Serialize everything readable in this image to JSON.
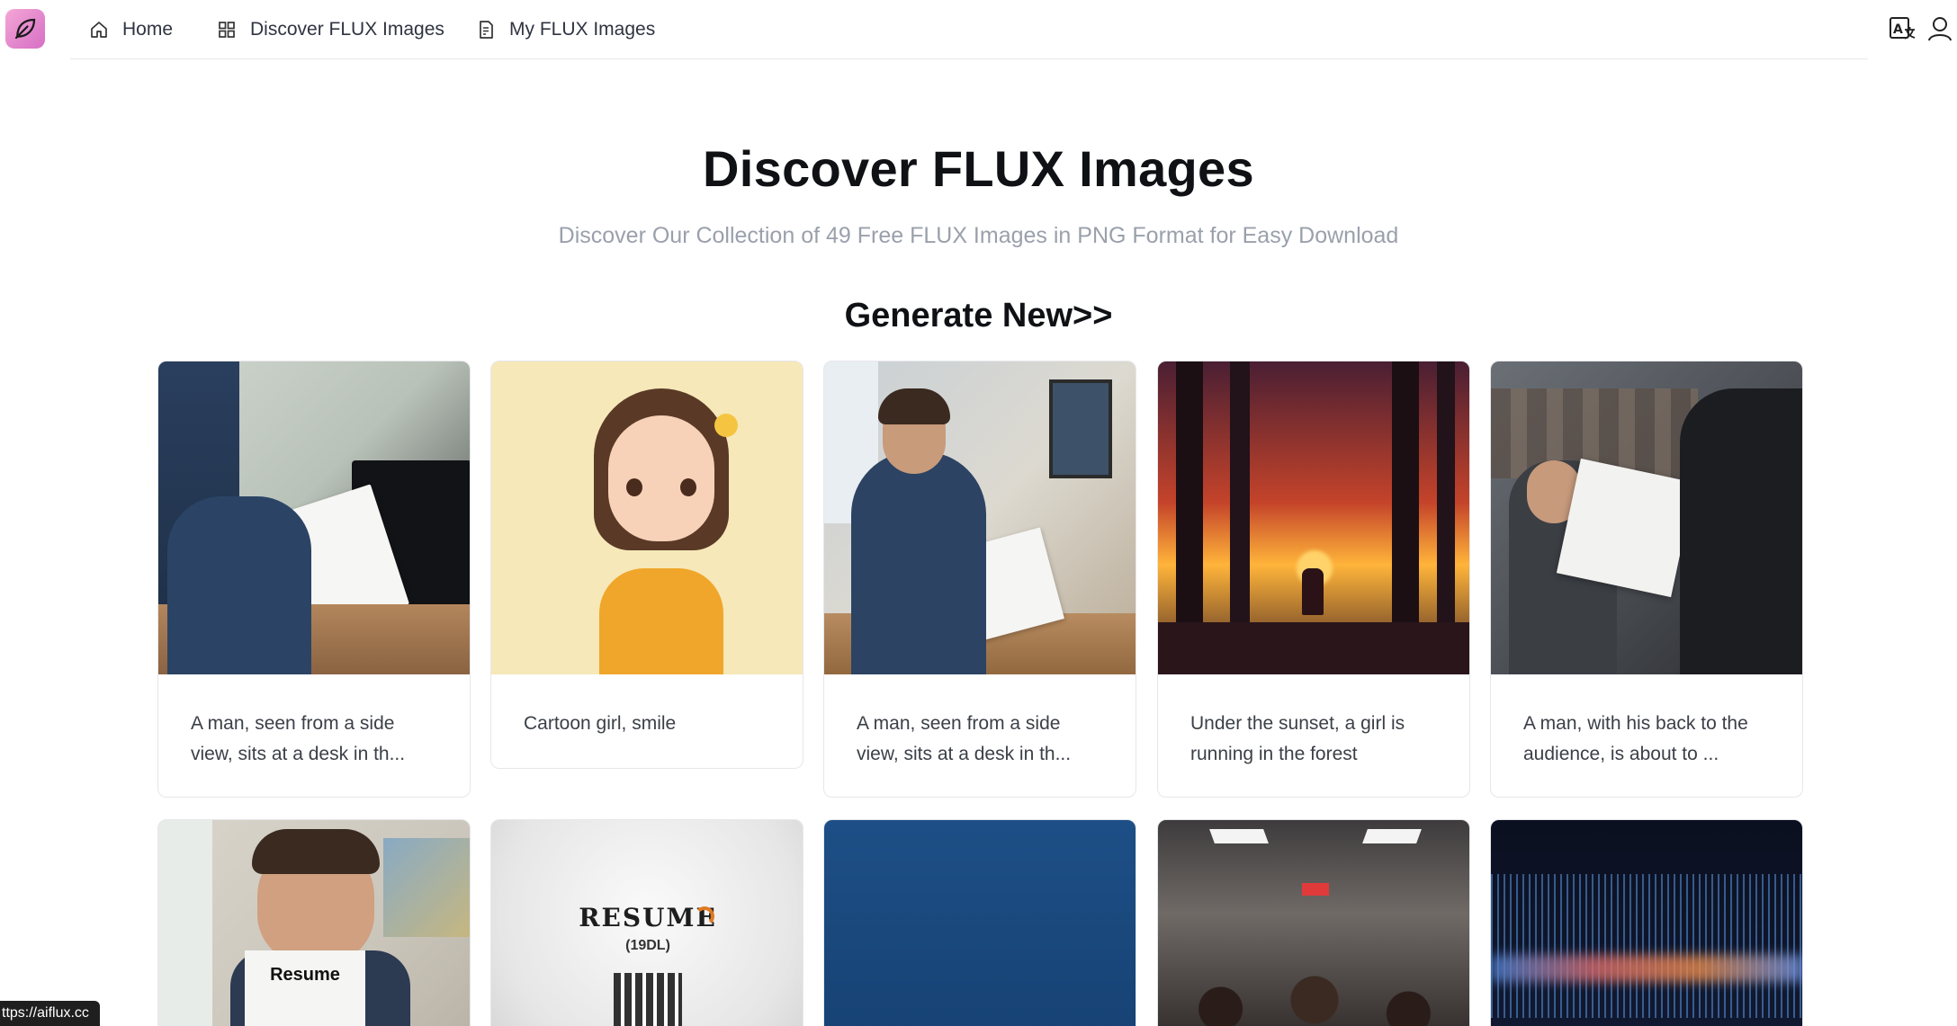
{
  "nav": {
    "items": [
      {
        "label": "Home",
        "icon": "home-icon"
      },
      {
        "label": "Discover FLUX Images",
        "icon": "grid-icon"
      },
      {
        "label": "My FLUX Images",
        "icon": "document-icon"
      }
    ],
    "right_icons": [
      "translate-icon",
      "user-icon"
    ]
  },
  "hero": {
    "title": "Discover FLUX Images",
    "subtitle": "Discover Our Collection of 49 Free FLUX Images in PNG Format for Easy Download",
    "generate_label": "Generate New>>"
  },
  "cards_row1": [
    {
      "caption": "A man, seen from a side view, sits at a desk in th..."
    },
    {
      "caption": "Cartoon girl, smile"
    },
    {
      "caption": "A man, seen from a side view, sits at a desk in th..."
    },
    {
      "caption": "Under the sunset, a girl is running in the forest"
    },
    {
      "caption": "A man, with his back to the audience, is about to ..."
    }
  ],
  "cards_row2": [
    {
      "image_text": "Resume"
    },
    {
      "image_text": "RESUME",
      "image_subtext": "(19DL)"
    },
    {},
    {},
    {}
  ],
  "status_bar": {
    "url": "ttps://aiflux.cc"
  },
  "colors": {
    "accent_logo": "#d66fc5",
    "muted_text": "#9aa0ab"
  }
}
